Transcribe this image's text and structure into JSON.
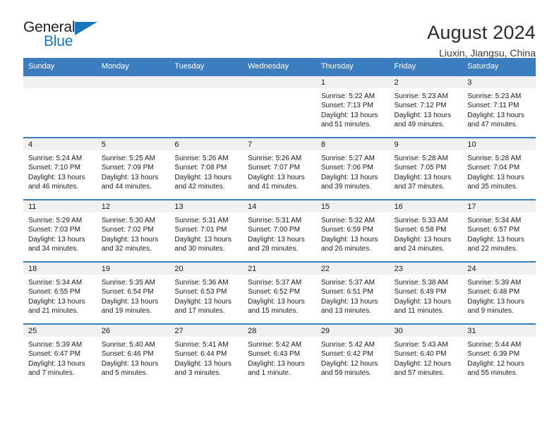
{
  "logo": {
    "name_top": "General",
    "name_bottom": "Blue",
    "triangle_icon": "blue-triangle-icon",
    "accent_color": "#1b75bb"
  },
  "header": {
    "title": "August 2024",
    "subtitle": "Liuxin, Jiangsu, China"
  },
  "theme": {
    "header_bg": "#3b7dbf",
    "daynum_bg": "#f0f0f0",
    "text": "#1a1a1a"
  },
  "weekdays": [
    "Sunday",
    "Monday",
    "Tuesday",
    "Wednesday",
    "Thursday",
    "Friday",
    "Saturday"
  ],
  "labels": {
    "sunrise_prefix": "Sunrise:",
    "sunset_prefix": "Sunset:",
    "daylight_prefix": "Daylight:"
  },
  "weeks": [
    [
      {
        "day": "",
        "empty": true
      },
      {
        "day": "",
        "empty": true
      },
      {
        "day": "",
        "empty": true
      },
      {
        "day": "",
        "empty": true
      },
      {
        "day": "1",
        "sunrise": "Sunrise: 5:22 AM",
        "sunset": "Sunset: 7:13 PM",
        "daylight": "Daylight: 13 hours and 51 minutes."
      },
      {
        "day": "2",
        "sunrise": "Sunrise: 5:23 AM",
        "sunset": "Sunset: 7:12 PM",
        "daylight": "Daylight: 13 hours and 49 minutes."
      },
      {
        "day": "3",
        "sunrise": "Sunrise: 5:23 AM",
        "sunset": "Sunset: 7:11 PM",
        "daylight": "Daylight: 13 hours and 47 minutes."
      }
    ],
    [
      {
        "day": "4",
        "sunrise": "Sunrise: 5:24 AM",
        "sunset": "Sunset: 7:10 PM",
        "daylight": "Daylight: 13 hours and 46 minutes."
      },
      {
        "day": "5",
        "sunrise": "Sunrise: 5:25 AM",
        "sunset": "Sunset: 7:09 PM",
        "daylight": "Daylight: 13 hours and 44 minutes."
      },
      {
        "day": "6",
        "sunrise": "Sunrise: 5:26 AM",
        "sunset": "Sunset: 7:08 PM",
        "daylight": "Daylight: 13 hours and 42 minutes."
      },
      {
        "day": "7",
        "sunrise": "Sunrise: 5:26 AM",
        "sunset": "Sunset: 7:07 PM",
        "daylight": "Daylight: 13 hours and 41 minutes."
      },
      {
        "day": "8",
        "sunrise": "Sunrise: 5:27 AM",
        "sunset": "Sunset: 7:06 PM",
        "daylight": "Daylight: 13 hours and 39 minutes."
      },
      {
        "day": "9",
        "sunrise": "Sunrise: 5:28 AM",
        "sunset": "Sunset: 7:05 PM",
        "daylight": "Daylight: 13 hours and 37 minutes."
      },
      {
        "day": "10",
        "sunrise": "Sunrise: 5:28 AM",
        "sunset": "Sunset: 7:04 PM",
        "daylight": "Daylight: 13 hours and 35 minutes."
      }
    ],
    [
      {
        "day": "11",
        "sunrise": "Sunrise: 5:29 AM",
        "sunset": "Sunset: 7:03 PM",
        "daylight": "Daylight: 13 hours and 34 minutes."
      },
      {
        "day": "12",
        "sunrise": "Sunrise: 5:30 AM",
        "sunset": "Sunset: 7:02 PM",
        "daylight": "Daylight: 13 hours and 32 minutes."
      },
      {
        "day": "13",
        "sunrise": "Sunrise: 5:31 AM",
        "sunset": "Sunset: 7:01 PM",
        "daylight": "Daylight: 13 hours and 30 minutes."
      },
      {
        "day": "14",
        "sunrise": "Sunrise: 5:31 AM",
        "sunset": "Sunset: 7:00 PM",
        "daylight": "Daylight: 13 hours and 28 minutes."
      },
      {
        "day": "15",
        "sunrise": "Sunrise: 5:32 AM",
        "sunset": "Sunset: 6:59 PM",
        "daylight": "Daylight: 13 hours and 26 minutes."
      },
      {
        "day": "16",
        "sunrise": "Sunrise: 5:33 AM",
        "sunset": "Sunset: 6:58 PM",
        "daylight": "Daylight: 13 hours and 24 minutes."
      },
      {
        "day": "17",
        "sunrise": "Sunrise: 5:34 AM",
        "sunset": "Sunset: 6:57 PM",
        "daylight": "Daylight: 13 hours and 22 minutes."
      }
    ],
    [
      {
        "day": "18",
        "sunrise": "Sunrise: 5:34 AM",
        "sunset": "Sunset: 6:55 PM",
        "daylight": "Daylight: 13 hours and 21 minutes."
      },
      {
        "day": "19",
        "sunrise": "Sunrise: 5:35 AM",
        "sunset": "Sunset: 6:54 PM",
        "daylight": "Daylight: 13 hours and 19 minutes."
      },
      {
        "day": "20",
        "sunrise": "Sunrise: 5:36 AM",
        "sunset": "Sunset: 6:53 PM",
        "daylight": "Daylight: 13 hours and 17 minutes."
      },
      {
        "day": "21",
        "sunrise": "Sunrise: 5:37 AM",
        "sunset": "Sunset: 6:52 PM",
        "daylight": "Daylight: 13 hours and 15 minutes."
      },
      {
        "day": "22",
        "sunrise": "Sunrise: 5:37 AM",
        "sunset": "Sunset: 6:51 PM",
        "daylight": "Daylight: 13 hours and 13 minutes."
      },
      {
        "day": "23",
        "sunrise": "Sunrise: 5:38 AM",
        "sunset": "Sunset: 6:49 PM",
        "daylight": "Daylight: 13 hours and 11 minutes."
      },
      {
        "day": "24",
        "sunrise": "Sunrise: 5:39 AM",
        "sunset": "Sunset: 6:48 PM",
        "daylight": "Daylight: 13 hours and 9 minutes."
      }
    ],
    [
      {
        "day": "25",
        "sunrise": "Sunrise: 5:39 AM",
        "sunset": "Sunset: 6:47 PM",
        "daylight": "Daylight: 13 hours and 7 minutes."
      },
      {
        "day": "26",
        "sunrise": "Sunrise: 5:40 AM",
        "sunset": "Sunset: 6:46 PM",
        "daylight": "Daylight: 13 hours and 5 minutes."
      },
      {
        "day": "27",
        "sunrise": "Sunrise: 5:41 AM",
        "sunset": "Sunset: 6:44 PM",
        "daylight": "Daylight: 13 hours and 3 minutes."
      },
      {
        "day": "28",
        "sunrise": "Sunrise: 5:42 AM",
        "sunset": "Sunset: 6:43 PM",
        "daylight": "Daylight: 13 hours and 1 minute."
      },
      {
        "day": "29",
        "sunrise": "Sunrise: 5:42 AM",
        "sunset": "Sunset: 6:42 PM",
        "daylight": "Daylight: 12 hours and 59 minutes."
      },
      {
        "day": "30",
        "sunrise": "Sunrise: 5:43 AM",
        "sunset": "Sunset: 6:40 PM",
        "daylight": "Daylight: 12 hours and 57 minutes."
      },
      {
        "day": "31",
        "sunrise": "Sunrise: 5:44 AM",
        "sunset": "Sunset: 6:39 PM",
        "daylight": "Daylight: 12 hours and 55 minutes."
      }
    ]
  ]
}
